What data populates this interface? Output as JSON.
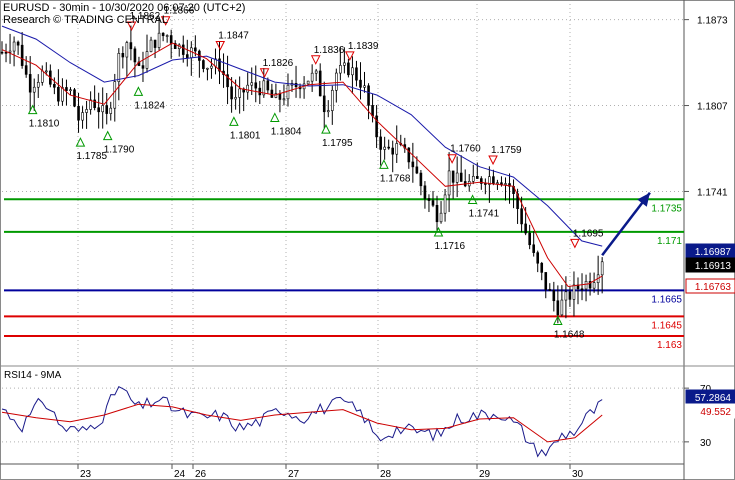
{
  "header": {
    "line1": "EURUSD - 30min - 10/30/2020 06:07:20 (UTC+2)",
    "line2": "Research © TRADING CENTRAL"
  },
  "colors": {
    "candle": "#000000",
    "ma_fast": "#cc0000",
    "ma_slow": "#1a1aaa",
    "resistance": "#009900",
    "pivot": "#00009c",
    "support": "#dd0000",
    "arrow": "#0a1a8a",
    "price_box": "#0a1a8a",
    "last_box": "#000000",
    "ma_box": "#cc0000",
    "rsi_line": "#1a1a8a",
    "rsi_ma": "#cc0000"
  },
  "chart_data": [
    {
      "type": "candlestick",
      "symbol": "EURUSD",
      "timeframe": "30min",
      "x_ticks": [
        "23",
        "24",
        "26",
        "27",
        "28",
        "29",
        "30"
      ],
      "y_ticks": [
        "1.1873",
        "1.1807",
        "1.1741"
      ],
      "ylim": [
        1.161,
        1.1885
      ],
      "levels": [
        {
          "label": "1.1735",
          "value": 1.1735,
          "kind": "resistance"
        },
        {
          "label": "1.171",
          "value": 1.171,
          "kind": "resistance"
        },
        {
          "label": "1.1665",
          "value": 1.1665,
          "kind": "pivot"
        },
        {
          "label": "1.1645",
          "value": 1.1645,
          "kind": "support"
        },
        {
          "label": "1.163",
          "value": 1.163,
          "kind": "support"
        }
      ],
      "price_tags": [
        {
          "label": "1.16987",
          "kind": "price"
        },
        {
          "label": "1.16913",
          "kind": "last"
        },
        {
          "label": "1.16763",
          "kind": "ma"
        }
      ],
      "swing_labels": [
        {
          "label": "1.1810",
          "t": 0.045,
          "value": 1.181,
          "dir": "low"
        },
        {
          "label": "1.1785",
          "t": 0.115,
          "value": 1.1785,
          "dir": "low"
        },
        {
          "label": "1.1790",
          "t": 0.155,
          "value": 1.179,
          "dir": "low"
        },
        {
          "label": "1.1862",
          "t": 0.19,
          "value": 1.1862,
          "dir": "high"
        },
        {
          "label": "1.1866",
          "t": 0.24,
          "value": 1.1866,
          "dir": "high"
        },
        {
          "label": "1.1824",
          "t": 0.2,
          "value": 1.1824,
          "dir": "low"
        },
        {
          "label": "1.1847",
          "t": 0.32,
          "value": 1.1847,
          "dir": "high"
        },
        {
          "label": "1.1801",
          "t": 0.34,
          "value": 1.1801,
          "dir": "low"
        },
        {
          "label": "1.1826",
          "t": 0.385,
          "value": 1.1826,
          "dir": "high"
        },
        {
          "label": "1.1804",
          "t": 0.4,
          "value": 1.1804,
          "dir": "low"
        },
        {
          "label": "1.1836",
          "t": 0.46,
          "value": 1.1836,
          "dir": "high"
        },
        {
          "label": "1.1839",
          "t": 0.51,
          "value": 1.1839,
          "dir": "high"
        },
        {
          "label": "1.1795",
          "t": 0.475,
          "value": 1.1795,
          "dir": "low"
        },
        {
          "label": "1.1768",
          "t": 0.56,
          "value": 1.1768,
          "dir": "low"
        },
        {
          "label": "1.1760",
          "t": 0.66,
          "value": 1.176,
          "dir": "high"
        },
        {
          "label": "1.1759",
          "t": 0.72,
          "value": 1.1759,
          "dir": "high"
        },
        {
          "label": "1.1741",
          "t": 0.69,
          "value": 1.1741,
          "dir": "low"
        },
        {
          "label": "1.1716",
          "t": 0.64,
          "value": 1.1716,
          "dir": "low"
        },
        {
          "label": "1.1648",
          "t": 0.815,
          "value": 1.1648,
          "dir": "low"
        },
        {
          "label": "1.1695",
          "t": 0.84,
          "value": 1.1695,
          "dir": "high"
        }
      ],
      "close_path": [
        [
          0.0,
          1.1848
        ],
        [
          0.02,
          1.1858
        ],
        [
          0.04,
          1.1822
        ],
        [
          0.06,
          1.1832
        ],
        [
          0.08,
          1.1815
        ],
        [
          0.1,
          1.1818
        ],
        [
          0.115,
          1.1792
        ],
        [
          0.13,
          1.1812
        ],
        [
          0.155,
          1.1797
        ],
        [
          0.17,
          1.1843
        ],
        [
          0.185,
          1.1858
        ],
        [
          0.2,
          1.1832
        ],
        [
          0.22,
          1.1855
        ],
        [
          0.24,
          1.1862
        ],
        [
          0.26,
          1.1852
        ],
        [
          0.28,
          1.1848
        ],
        [
          0.3,
          1.1838
        ],
        [
          0.32,
          1.1838
        ],
        [
          0.34,
          1.1808
        ],
        [
          0.36,
          1.1822
        ],
        [
          0.385,
          1.182
        ],
        [
          0.4,
          1.181
        ],
        [
          0.42,
          1.1818
        ],
        [
          0.44,
          1.1826
        ],
        [
          0.46,
          1.183
        ],
        [
          0.475,
          1.1802
        ],
        [
          0.49,
          1.1832
        ],
        [
          0.51,
          1.1836
        ],
        [
          0.53,
          1.1822
        ],
        [
          0.545,
          1.179
        ],
        [
          0.56,
          1.1772
        ],
        [
          0.58,
          1.1775
        ],
        [
          0.6,
          1.1765
        ],
        [
          0.62,
          1.1738
        ],
        [
          0.64,
          1.1722
        ],
        [
          0.655,
          1.1755
        ],
        [
          0.67,
          1.1748
        ],
        [
          0.69,
          1.1747
        ],
        [
          0.71,
          1.1752
        ],
        [
          0.73,
          1.1752
        ],
        [
          0.745,
          1.1745
        ],
        [
          0.76,
          1.1722
        ],
        [
          0.78,
          1.169
        ],
        [
          0.8,
          1.1665
        ],
        [
          0.815,
          1.1652
        ],
        [
          0.83,
          1.166
        ],
        [
          0.85,
          1.167
        ],
        [
          0.865,
          1.1672
        ],
        [
          0.88,
          1.169
        ]
      ],
      "ma_fast_path": [
        [
          0.0,
          1.185
        ],
        [
          0.05,
          1.1838
        ],
        [
          0.1,
          1.1815
        ],
        [
          0.15,
          1.1808
        ],
        [
          0.2,
          1.184
        ],
        [
          0.25,
          1.1855
        ],
        [
          0.3,
          1.1843
        ],
        [
          0.35,
          1.182
        ],
        [
          0.4,
          1.1815
        ],
        [
          0.45,
          1.1823
        ],
        [
          0.5,
          1.1825
        ],
        [
          0.55,
          1.1795
        ],
        [
          0.6,
          1.177
        ],
        [
          0.65,
          1.1745
        ],
        [
          0.7,
          1.1748
        ],
        [
          0.75,
          1.1745
        ],
        [
          0.8,
          1.169
        ],
        [
          0.83,
          1.1668
        ],
        [
          0.86,
          1.167
        ],
        [
          0.88,
          1.1676
        ]
      ],
      "ma_slow_path": [
        [
          0.0,
          1.1868
        ],
        [
          0.05,
          1.1858
        ],
        [
          0.1,
          1.184
        ],
        [
          0.15,
          1.1825
        ],
        [
          0.2,
          1.183
        ],
        [
          0.25,
          1.1842
        ],
        [
          0.3,
          1.1845
        ],
        [
          0.35,
          1.1835
        ],
        [
          0.4,
          1.1825
        ],
        [
          0.45,
          1.1822
        ],
        [
          0.5,
          1.1823
        ],
        [
          0.55,
          1.1815
        ],
        [
          0.6,
          1.18
        ],
        [
          0.65,
          1.1775
        ],
        [
          0.7,
          1.176
        ],
        [
          0.75,
          1.1752
        ],
        [
          0.8,
          1.173
        ],
        [
          0.85,
          1.1703
        ],
        [
          0.88,
          1.1699
        ]
      ],
      "projection": [
        [
          0.88,
          1.1692
        ],
        [
          0.95,
          1.174
        ]
      ]
    },
    {
      "type": "line",
      "title": "RSI14 - 9MA",
      "y_ticks": [
        "70",
        "30"
      ],
      "ylim": [
        15,
        85
      ],
      "price_tags": [
        {
          "label": "57.2864",
          "kind": "rsi"
        },
        {
          "label": "49.552",
          "kind": "rsi_ma"
        }
      ],
      "rsi_path": [
        [
          0.0,
          55
        ],
        [
          0.03,
          42
        ],
        [
          0.06,
          62
        ],
        [
          0.09,
          40
        ],
        [
          0.12,
          38
        ],
        [
          0.15,
          50
        ],
        [
          0.17,
          72
        ],
        [
          0.2,
          55
        ],
        [
          0.23,
          62
        ],
        [
          0.26,
          52
        ],
        [
          0.29,
          48
        ],
        [
          0.32,
          50
        ],
        [
          0.35,
          40
        ],
        [
          0.38,
          46
        ],
        [
          0.41,
          55
        ],
        [
          0.44,
          48
        ],
        [
          0.47,
          55
        ],
        [
          0.5,
          60
        ],
        [
          0.53,
          50
        ],
        [
          0.55,
          32
        ],
        [
          0.58,
          40
        ],
        [
          0.61,
          38
        ],
        [
          0.64,
          35
        ],
        [
          0.67,
          48
        ],
        [
          0.7,
          50
        ],
        [
          0.73,
          52
        ],
        [
          0.76,
          40
        ],
        [
          0.78,
          25
        ],
        [
          0.8,
          22
        ],
        [
          0.82,
          35
        ],
        [
          0.84,
          38
        ],
        [
          0.86,
          50
        ],
        [
          0.88,
          58
        ]
      ],
      "rsi_ma_path": [
        [
          0.0,
          52
        ],
        [
          0.05,
          48
        ],
        [
          0.1,
          45
        ],
        [
          0.15,
          50
        ],
        [
          0.2,
          58
        ],
        [
          0.25,
          56
        ],
        [
          0.3,
          50
        ],
        [
          0.35,
          46
        ],
        [
          0.4,
          50
        ],
        [
          0.45,
          52
        ],
        [
          0.5,
          54
        ],
        [
          0.55,
          44
        ],
        [
          0.6,
          39
        ],
        [
          0.65,
          40
        ],
        [
          0.7,
          47
        ],
        [
          0.75,
          48
        ],
        [
          0.8,
          30
        ],
        [
          0.84,
          33
        ],
        [
          0.88,
          50
        ]
      ]
    }
  ]
}
